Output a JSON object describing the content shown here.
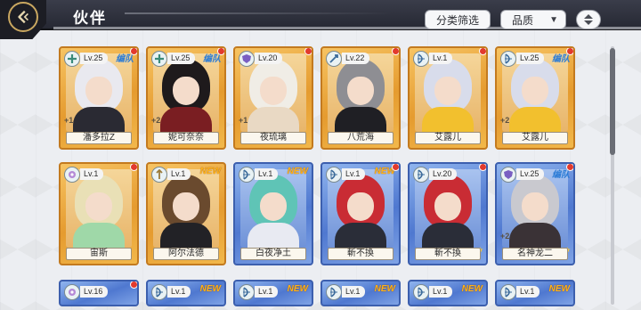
{
  "header": {
    "title": "伙伴",
    "back_icon": "back-arrow-icon",
    "filter_label": "分类筛选",
    "quality_label": "品质",
    "quality_caret": "▼",
    "sort_icon": "sort-toggle-icon"
  },
  "colors": {
    "gold_frame": "#e59b2f",
    "blue_frame": "#4f78d0",
    "red_dot": "#e23a2d",
    "team_tag": "#2a7bd6",
    "new_tag": "#ffb21a"
  },
  "cards_row1": [
    {
      "name": "潘多拉Z",
      "level": "Lv.25",
      "tag": "编队",
      "frame": "gold",
      "role": "heal-role-icon",
      "plus": "+1",
      "dot": true,
      "hair": "#e9e9ef",
      "body": "#2a2a33"
    },
    {
      "name": "妮可奈奈",
      "level": "Lv.25",
      "tag": "编队",
      "frame": "gold",
      "role": "heal-role-icon",
      "plus": "+2",
      "dot": true,
      "hair": "#1e1a1c",
      "body": "#7a1e22"
    },
    {
      "name": "夜琉璃",
      "level": "Lv.20",
      "tag": "",
      "frame": "gold",
      "role": "shield-role-icon",
      "plus": "+1",
      "dot": true,
      "hair": "#f0ede6",
      "body": "#e9d9c4"
    },
    {
      "name": "八荒海",
      "level": "Lv.22",
      "tag": "",
      "frame": "gold",
      "role": "sword-role-icon",
      "plus": "",
      "dot": true,
      "hair": "#8e8e93",
      "body": "#1f1f24"
    },
    {
      "name": "艾露儿",
      "level": "Lv.1",
      "tag": "",
      "frame": "gold",
      "role": "bow-role-icon",
      "plus": "",
      "dot": true,
      "hair": "#d8dceb",
      "body": "#f2c02e"
    },
    {
      "name": "艾露儿",
      "level": "Lv.25",
      "tag": "编队",
      "frame": "gold",
      "role": "bow-role-icon",
      "plus": "+2",
      "dot": true,
      "hair": "#d8dceb",
      "body": "#f2c02e"
    }
  ],
  "cards_row2": [
    {
      "name": "宙斯",
      "level": "Lv.1",
      "tag": "",
      "frame": "gold",
      "role": "magic-role-icon",
      "plus": "",
      "dot": true,
      "stars": "",
      "hair": "#e9e0b6",
      "body": "#9fd8a8"
    },
    {
      "name": "阿尔法德",
      "level": "Lv.1",
      "tag": "NEW",
      "frame": "gold",
      "role": "lance-role-icon",
      "plus": "",
      "dot": false,
      "stars": "",
      "hair": "#6a4a2e",
      "body": "#222226"
    },
    {
      "name": "白夜净土",
      "level": "Lv.1",
      "tag": "NEW",
      "frame": "blue",
      "role": "bow-role-icon",
      "plus": "",
      "dot": false,
      "stars": "",
      "hair": "#5fc4b6",
      "body": "#e8eaf2"
    },
    {
      "name": "斬不換",
      "level": "Lv.1",
      "tag": "NEW",
      "frame": "blue",
      "role": "bow-role-icon",
      "plus": "",
      "dot": true,
      "stars": "",
      "hair": "#c92c34",
      "body": "#2a2d38"
    },
    {
      "name": "斬不換",
      "level": "Lv.20",
      "tag": "",
      "frame": "blue",
      "role": "bow-role-icon",
      "plus": "",
      "dot": true,
      "stars": "★",
      "hair": "#c92c34",
      "body": "#2a2d38"
    },
    {
      "name": "名神龙二",
      "level": "Lv.25",
      "tag": "编队",
      "frame": "blue",
      "role": "shield-role-icon",
      "plus": "+2",
      "dot": true,
      "stars": "★★",
      "hair": "#c9c9cf",
      "body": "#3a3236"
    }
  ],
  "cards_row3": [
    {
      "level": "Lv.16",
      "tag": "",
      "frame": "blue",
      "role": "magic-role-icon",
      "dot": true
    },
    {
      "level": "Lv.1",
      "tag": "NEW",
      "frame": "blue",
      "role": "bow-role-icon",
      "dot": false
    },
    {
      "level": "Lv.1",
      "tag": "NEW",
      "frame": "blue",
      "role": "bow-role-icon",
      "dot": false
    },
    {
      "level": "Lv.1",
      "tag": "NEW",
      "frame": "blue",
      "role": "bow-role-icon",
      "dot": false
    },
    {
      "level": "Lv.1",
      "tag": "NEW",
      "frame": "blue",
      "role": "bow-role-icon",
      "dot": false
    },
    {
      "level": "Lv.1",
      "tag": "NEW",
      "frame": "blue",
      "role": "bow-role-icon",
      "dot": false
    }
  ]
}
